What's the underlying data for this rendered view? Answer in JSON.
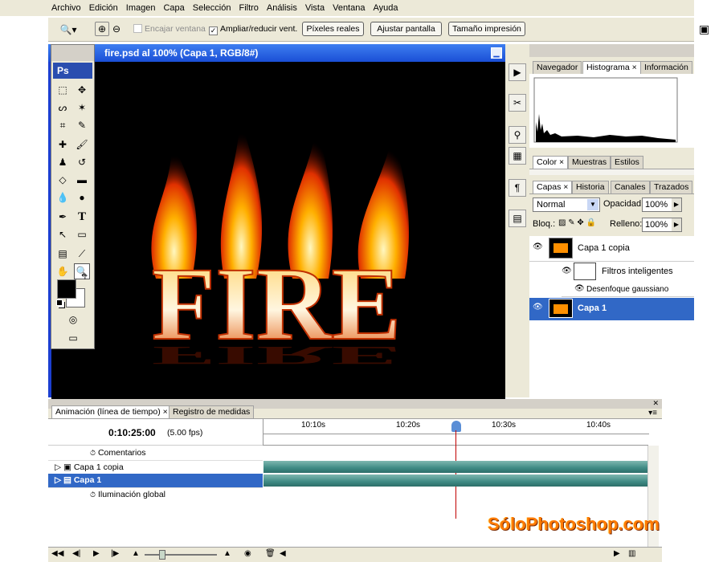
{
  "menu": {
    "items": [
      "Archivo",
      "Edición",
      "Imagen",
      "Capa",
      "Selección",
      "Filtro",
      "Análisis",
      "Vista",
      "Ventana",
      "Ayuda"
    ]
  },
  "options_bar": {
    "tool_icon": "zoom-icon",
    "encajar_label": "Encajar ventana",
    "ampliar_label": "Ampliar/reducir vent.",
    "btn_pixeles": "Píxeles reales",
    "btn_ajustar": "Ajustar pantalla",
    "btn_tamano": "Tamaño impresión"
  },
  "document": {
    "title": "fire.psd al 100% (Capa 1, RGB/8#)",
    "canvas_text": "FIRE"
  },
  "toolbox": {
    "logo": "Ps"
  },
  "panels": {
    "top_tabs": [
      "Navegador",
      "Histograma",
      "Información"
    ],
    "color_tabs": [
      "Color",
      "Muestras",
      "Estilos"
    ],
    "layer_tabs": [
      "Capas",
      "Historia",
      "Canales",
      "Trazados"
    ],
    "blend_mode": "Normal",
    "opacity_label": "Opacidad:",
    "opacity_value": "100%",
    "lock_label": "Bloq.:",
    "fill_label": "Relleno:",
    "fill_value": "100%",
    "layers": [
      {
        "name": "Capa 1 copia",
        "selected": false
      },
      {
        "name": "Filtros inteligentes",
        "selected": false
      },
      {
        "name": "Desenfoque gaussiano",
        "selected": false
      },
      {
        "name": "Capa 1",
        "selected": true
      }
    ]
  },
  "timeline": {
    "tabs": [
      "Animación (línea de tiempo)",
      "Registro de medidas"
    ],
    "timecode": "0:10:25:00",
    "fps": "(5.00 fps)",
    "ruler": [
      "10:10s",
      "10:20s",
      "10:30s",
      "10:40s"
    ],
    "rows": [
      "Comentarios",
      "Capa 1 copia",
      "Capa 1",
      "Iluminación global"
    ]
  },
  "watermark": "SóloPhotoshop.com",
  "colors": {
    "selection": "#3168c6",
    "title_bar": "#1a4fd6",
    "watermark": "#ff7a00"
  }
}
